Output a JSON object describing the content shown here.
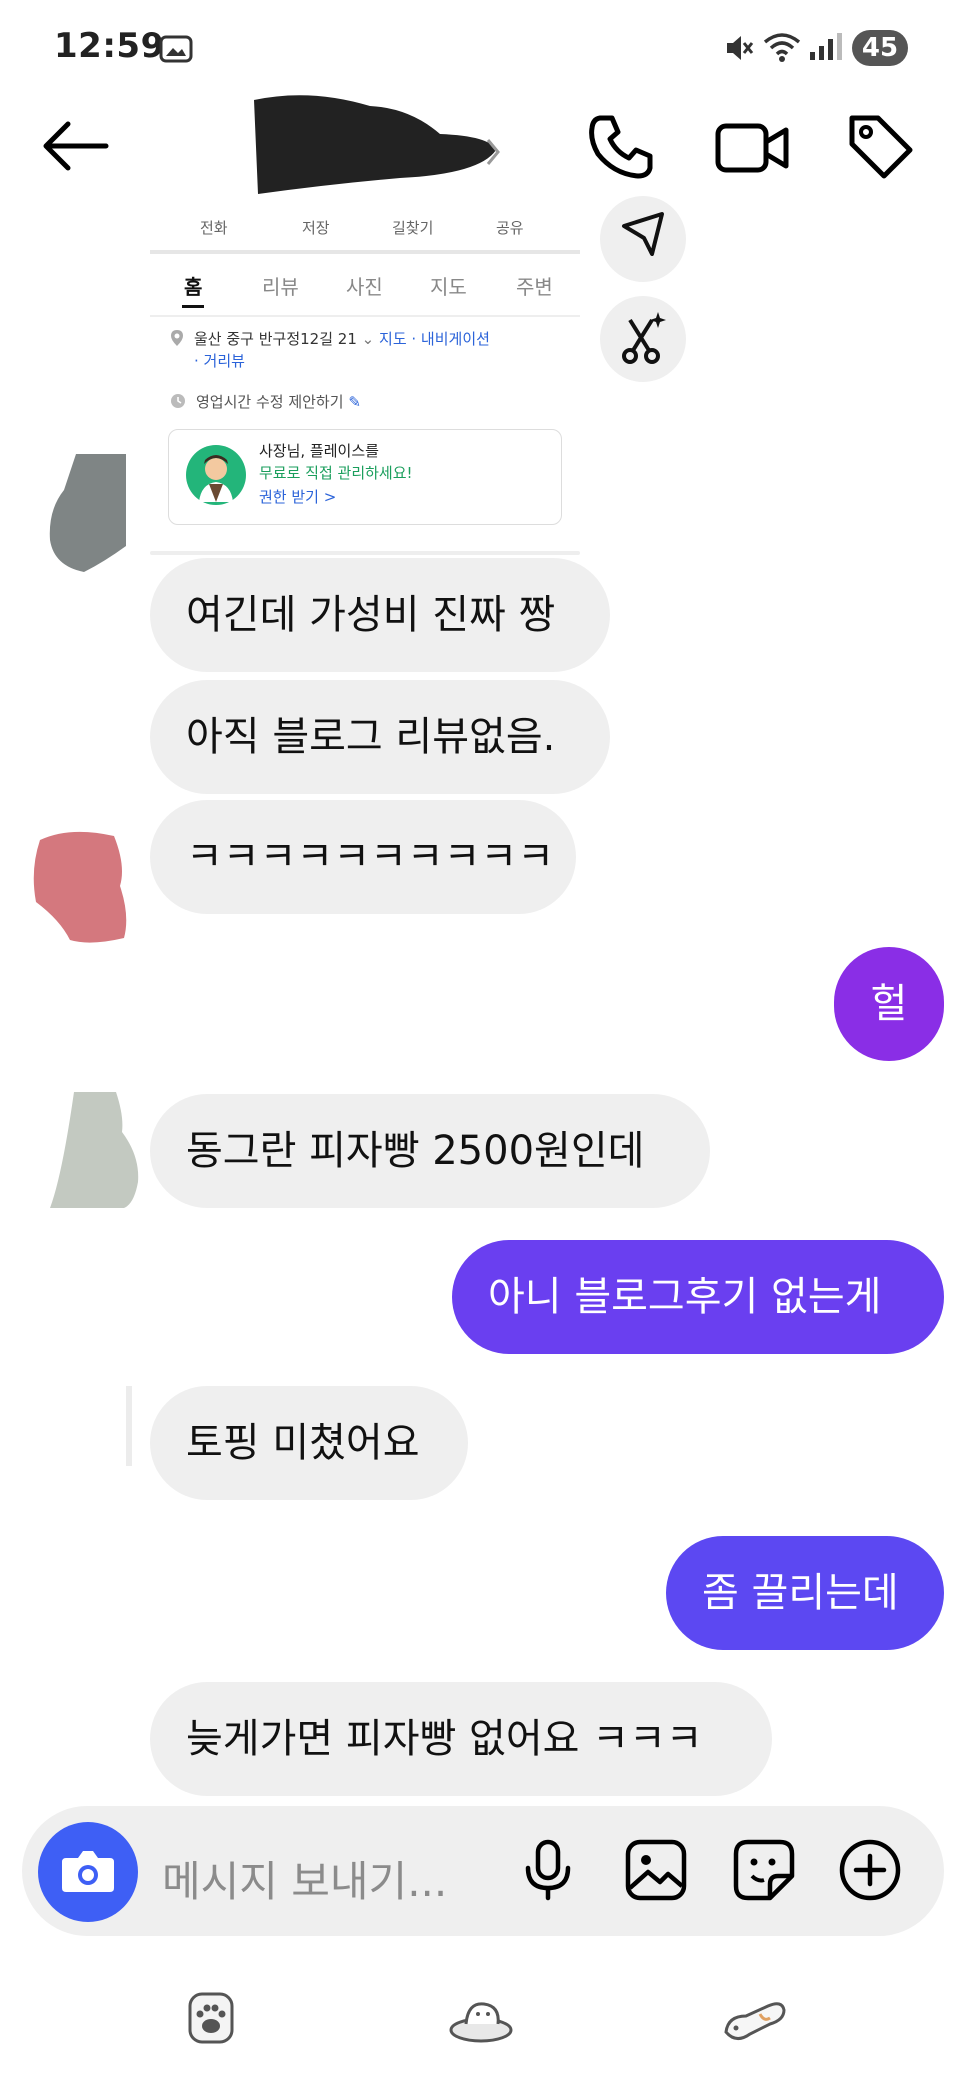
{
  "status_bar": {
    "time": "12:59",
    "battery": "45"
  },
  "place_card": {
    "top_tabs": [
      "전화",
      "저장",
      "길찾기",
      "공유"
    ],
    "tabs": [
      "홈",
      "리뷰",
      "사진",
      "지도",
      "주변"
    ],
    "address": "울산 중구 반구정12길 21",
    "address_links": "지도 · 내비게이션",
    "address_link2": "· 거리뷰",
    "hours_text": "영업시간 수정 제안하기",
    "promo_line1": "사장님, 플레이스를",
    "promo_line2": "무료로 직접 관리하세요!",
    "promo_link": "권한 받기 >"
  },
  "messages": [
    {
      "side": "in",
      "text": "여긴데 가성비 진짜 짱"
    },
    {
      "side": "in",
      "text": "아직 블로그 리뷰없음."
    },
    {
      "side": "in",
      "text": "ㅋㅋㅋㅋㅋㅋㅋㅋㅋㅋ"
    },
    {
      "side": "out",
      "text": "헐"
    },
    {
      "side": "in",
      "text": "동그란 피자빵 2500원인데"
    },
    {
      "side": "out",
      "text": "아니 블로그후기 없는게"
    },
    {
      "side": "in",
      "text": "토핑 미쳤어요"
    },
    {
      "side": "out",
      "text": "좀 끌리는데"
    },
    {
      "side": "in",
      "text": "늦게가면 피자빵 없어요 ㅋㅋㅋ"
    }
  ],
  "composer": {
    "placeholder": "메시지 보내기..."
  },
  "colors": {
    "incoming_bubble": "#efefef",
    "outgoing_purple": "#8a2ee6",
    "outgoing_violet": "#6a3ff0",
    "outgoing_blue": "#5c48f2",
    "camera_button": "#3e5ff5"
  },
  "icons": {
    "header": [
      "back-arrow-icon",
      "phone-icon",
      "video-camera-icon",
      "tag-icon"
    ],
    "composer": [
      "camera-icon",
      "microphone-icon",
      "image-icon",
      "sticker-icon",
      "plus-circle-icon"
    ],
    "nav": [
      "paw-icon",
      "dog-bed-icon",
      "dog-icon"
    ]
  }
}
